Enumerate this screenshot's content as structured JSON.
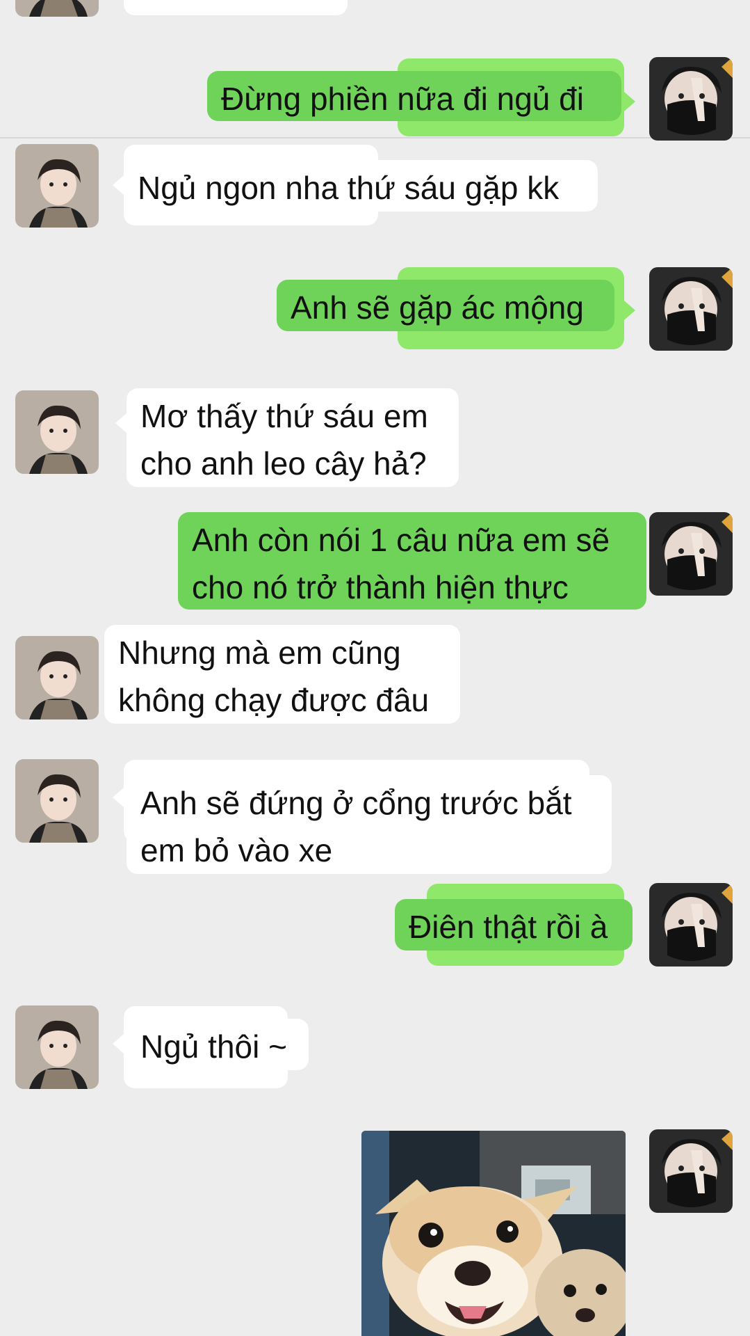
{
  "colors": {
    "background": "#ededed",
    "incoming_bubble": "#ffffff",
    "outgoing_bubble": "#6fd35a",
    "outgoing_bubble_light": "#8fe86a"
  },
  "avatars": {
    "contact": "contact-avatar",
    "self": "self-avatar-masked"
  },
  "messages": [
    {
      "side": "out",
      "text": "Đừng phiền nữa đi ngủ đi"
    },
    {
      "side": "in",
      "text": "Ngủ ngon nha thứ sáu gặp kk"
    },
    {
      "side": "out",
      "text": "Anh sẽ gặp ác mộng"
    },
    {
      "side": "in",
      "text": "Mơ thấy thứ sáu em\ncho anh leo cây hả?"
    },
    {
      "side": "out",
      "text": "Anh còn nói 1 câu nữa em sẽ\ncho nó trở thành hiện thực"
    },
    {
      "side": "in",
      "text": "Nhưng mà em cũng\nkhông chạy được đâu"
    },
    {
      "side": "in",
      "text": "Anh sẽ đứng ở cổng trước bắt\nem bỏ vào xe"
    },
    {
      "side": "out",
      "text": "Điên thật rồi à"
    },
    {
      "side": "in",
      "text": "Ngủ thôi ~"
    },
    {
      "side": "out",
      "type": "image",
      "icon": "chihuahua-photo"
    }
  ]
}
